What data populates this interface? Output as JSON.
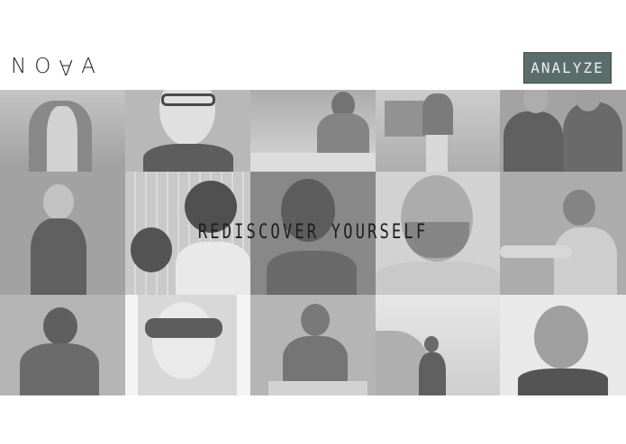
{
  "app": {
    "logo_text": "NOVA",
    "logo_first": "N",
    "logo_o": "O",
    "logo_v": "A"
  },
  "header": {
    "analyze_label": "ANALYZE"
  },
  "hero": {
    "tagline": "REDISCOVER YOURSELF"
  },
  "colors": {
    "accent": "#5b6d6a",
    "text": "#1e1e1e",
    "background": "#ffffff"
  },
  "photos": [
    {
      "name": "photo-1"
    },
    {
      "name": "photo-2"
    },
    {
      "name": "photo-3"
    },
    {
      "name": "photo-4"
    },
    {
      "name": "photo-5"
    },
    {
      "name": "photo-6"
    },
    {
      "name": "photo-7"
    },
    {
      "name": "photo-8"
    },
    {
      "name": "photo-9"
    },
    {
      "name": "photo-10"
    },
    {
      "name": "photo-11"
    },
    {
      "name": "photo-12"
    },
    {
      "name": "photo-13"
    },
    {
      "name": "photo-14"
    },
    {
      "name": "photo-15"
    }
  ]
}
